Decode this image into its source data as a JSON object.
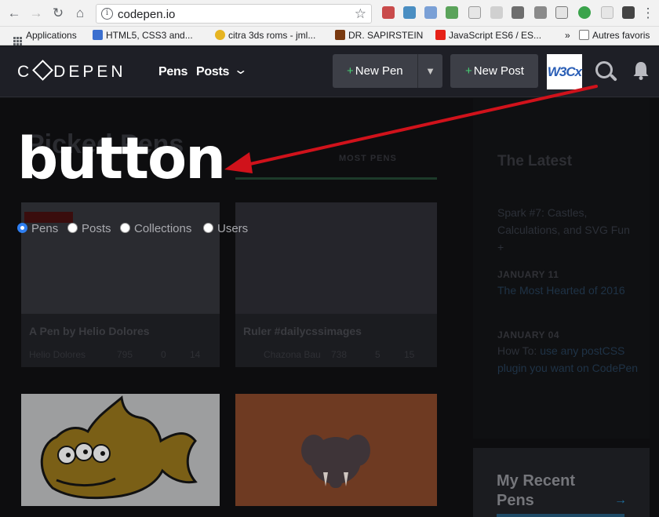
{
  "browser": {
    "url": "codepen.io",
    "bookmarks": [
      {
        "label": "Applications"
      },
      {
        "label": "HTML5, CSS3 and..."
      },
      {
        "label": "citra 3ds roms - jml..."
      },
      {
        "label": "DR. SAPIRSTEIN"
      },
      {
        "label": "JavaScript ES6 / ES..."
      },
      {
        "label": "»"
      },
      {
        "label": "Autres favoris"
      }
    ]
  },
  "header": {
    "logo": "DEPEN",
    "logo_prefix": "C",
    "nav": [
      {
        "label": "Pens"
      },
      {
        "label": "Posts"
      }
    ],
    "new_pen": "New Pen",
    "new_post": "New Post",
    "w3c_badge": "W3Cx"
  },
  "overlay": {
    "search_term": "button",
    "filters": [
      {
        "label": "Pens",
        "selected": true
      },
      {
        "label": "Posts",
        "selected": false
      },
      {
        "label": "Collections",
        "selected": false
      },
      {
        "label": "Users",
        "selected": false
      }
    ]
  },
  "background": {
    "heading": "Picked Pens",
    "tab": "MOST PENS",
    "cards": [
      {
        "title": "A Pen by Helio Dolores",
        "author": "Helio Dolores",
        "views": "795",
        "comments": "0",
        "hearts": "14"
      },
      {
        "title": "Ruler #dailycssimages",
        "author": "Chazona Bau",
        "views": "738",
        "comments": "5",
        "hearts": "15"
      }
    ],
    "sidebar": {
      "title": "The Latest",
      "items": [
        {
          "date": "",
          "text": "Spark #7: Castles, Calculations, and SVG Fun +"
        },
        {
          "date": "JANUARY 11",
          "text": "The Most Hearted of 2016"
        },
        {
          "date": "JANUARY 04",
          "text_prefix": "How To: ",
          "text": "use any postCSS plugin you want on CodePen"
        }
      ]
    },
    "recent_title_1": "My Recent",
    "recent_title_2": "Pens",
    "recent_arrow": "→"
  },
  "colors": {
    "accent": "#47cf73",
    "radio_selected": "#2f7ff1",
    "arrow": "#d0121b"
  }
}
